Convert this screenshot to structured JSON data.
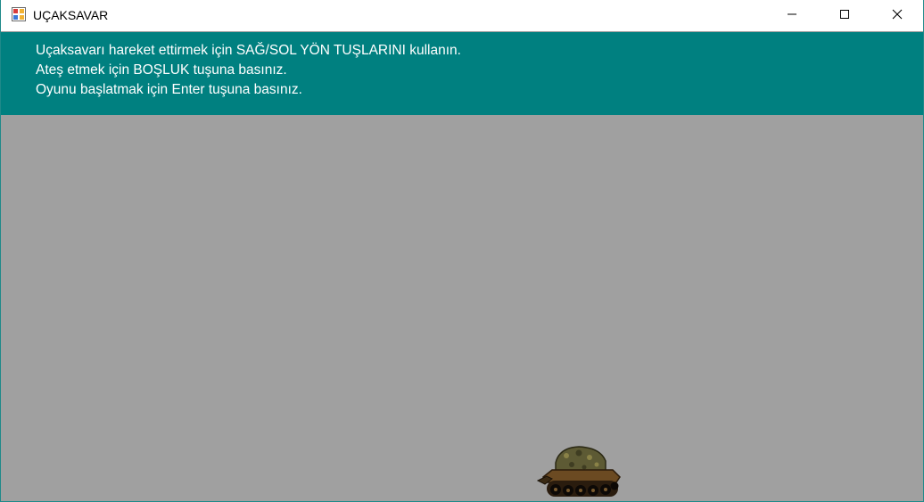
{
  "window": {
    "title": "UÇAKSAVAR"
  },
  "controls": {
    "minimize": "minimize-icon",
    "maximize": "maximize-icon",
    "close": "close-icon"
  },
  "instructions": {
    "line1": "Uçaksavarı hareket ettirmek için SAĞ/SOL YÖN TUŞLARINI kullanın.",
    "line2": "Ateş etmek için BOŞLUK tuşuna basınız.",
    "line3": "Oyunu başlatmak için Enter tuşuna basınız."
  },
  "colors": {
    "instructions_bg": "#008080",
    "game_bg": "#a0a0a0"
  },
  "game": {
    "player": "tank"
  }
}
